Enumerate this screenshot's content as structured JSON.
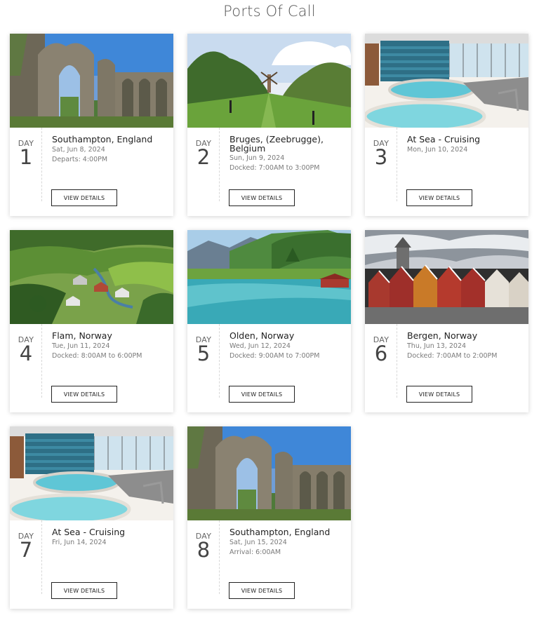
{
  "page_title": "Ports Of Call",
  "day_label": "DAY",
  "button_label": "VIEW DETAILS",
  "ports": [
    {
      "day": "1",
      "name": "Southampton, England",
      "date": "Sat, Jun 8, 2024",
      "time": "Departs: 4:00PM",
      "image": "ruins-image"
    },
    {
      "day": "2",
      "name": "Bruges, (Zeebrugge), Belgium",
      "date": "Sun, Jun 9, 2024",
      "time": "Docked: 7:00AM to 3:00PM",
      "image": "windmill-avenue-image"
    },
    {
      "day": "3",
      "name": "At Sea - Cruising",
      "date": "Mon, Jun 10, 2024",
      "time": "",
      "image": "ship-spa-pool-image"
    },
    {
      "day": "4",
      "name": "Flam, Norway",
      "date": "Tue, Jun 11, 2024",
      "time": "Docked: 8:00AM to 6:00PM",
      "image": "valley-village-image"
    },
    {
      "day": "5",
      "name": "Olden, Norway",
      "date": "Wed, Jun 12, 2024",
      "time": "Docked: 9:00AM to 7:00PM",
      "image": "fjord-river-image"
    },
    {
      "day": "6",
      "name": "Bergen, Norway",
      "date": "Thu, Jun 13, 2024",
      "time": "Docked: 7:00AM to 2:00PM",
      "image": "bryggen-houses-image"
    },
    {
      "day": "7",
      "name": "At Sea - Cruising",
      "date": "Fri, Jun 14, 2024",
      "time": "",
      "image": "ship-spa-pool-image"
    },
    {
      "day": "8",
      "name": "Southampton, England",
      "date": "Sat, Jun 15, 2024",
      "time": "Arrival: 6:00AM",
      "image": "ruins-image"
    }
  ]
}
